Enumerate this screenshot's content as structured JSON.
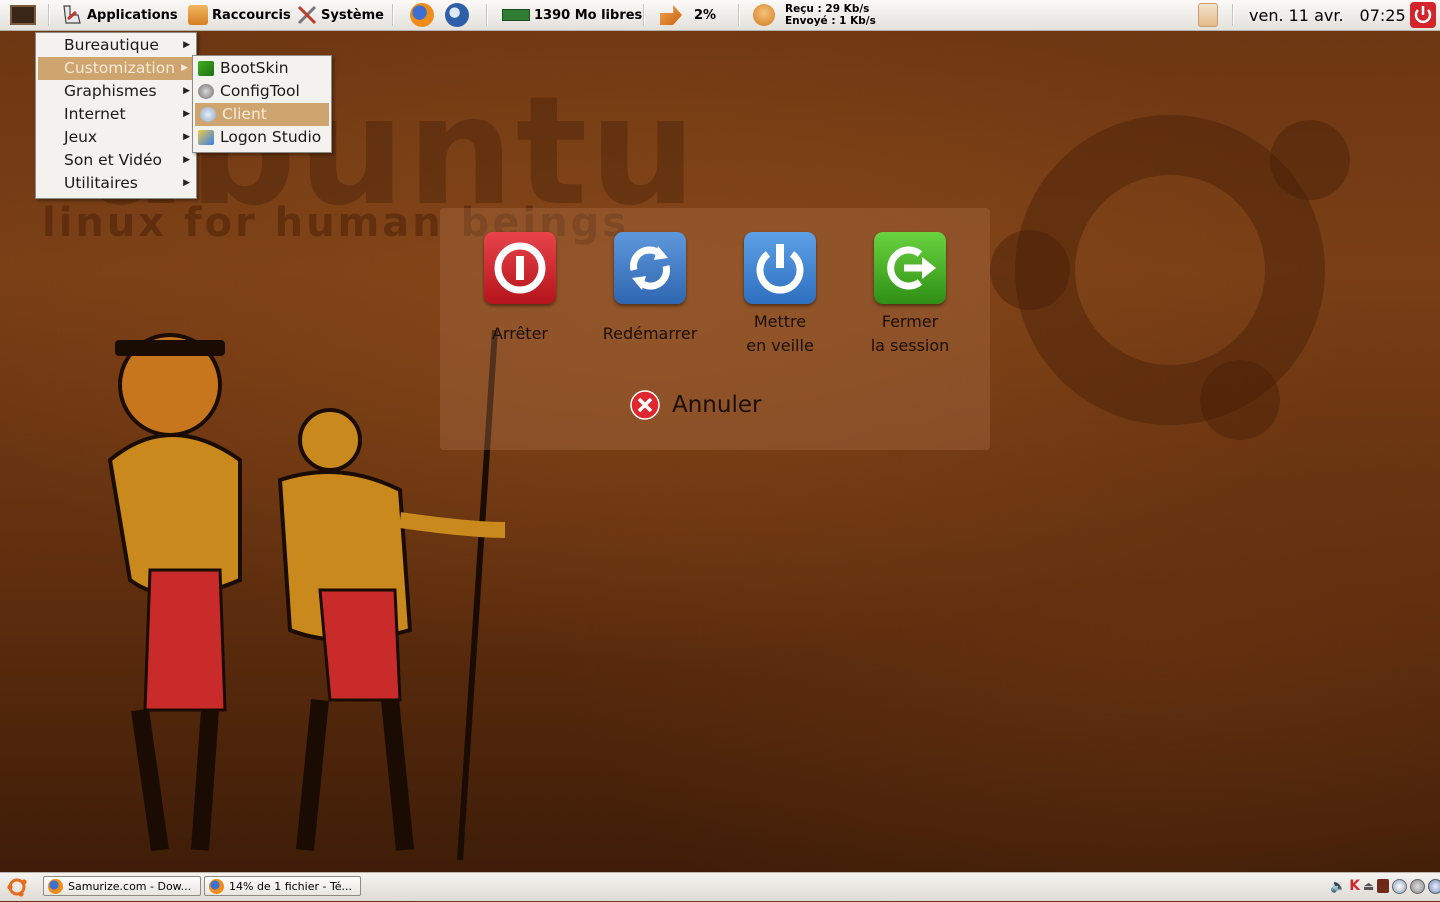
{
  "top_panel": {
    "applications_label": "Applications",
    "places_label": "Raccourcis",
    "system_label": "Système",
    "memory_text": "1390 Mo libres",
    "cpu_text": "2%",
    "net_received": "Reçu : 29 Kb/s",
    "net_sent": "Envoyé : 1 Kb/s",
    "date_text": "ven. 11 avr.",
    "time_text": "07:25"
  },
  "applications_menu": {
    "items": [
      {
        "label": "Bureautique"
      },
      {
        "label": "Customization"
      },
      {
        "label": "Graphismes"
      },
      {
        "label": "Internet"
      },
      {
        "label": "Jeux"
      },
      {
        "label": "Son et Vidéo"
      },
      {
        "label": "Utilitaires"
      }
    ]
  },
  "customization_submenu": {
    "items": [
      {
        "label": "BootSkin"
      },
      {
        "label": "ConfigTool"
      },
      {
        "label": "Client"
      },
      {
        "label": "Logon Studio"
      }
    ]
  },
  "wallpaper": {
    "brand": "ubuntu",
    "tagline": "linux for human beings"
  },
  "logout_dialog": {
    "actions": [
      {
        "label": "Arrêter"
      },
      {
        "label": "Redémarrer"
      },
      {
        "label": "Mettre\nen veille"
      },
      {
        "label": "Fermer\nla session"
      }
    ],
    "cancel_label": "Annuler"
  },
  "bottom_panel": {
    "tasks": [
      {
        "label": "Samurize.com - Dow..."
      },
      {
        "label": "14% de 1 fichier - Té..."
      }
    ]
  },
  "colors": {
    "shutdown": "#d3232b",
    "restart": "#3f7fc9",
    "suspend": "#3d86d1",
    "logout": "#3fae22",
    "menu_highlight": "#cfa56f"
  }
}
